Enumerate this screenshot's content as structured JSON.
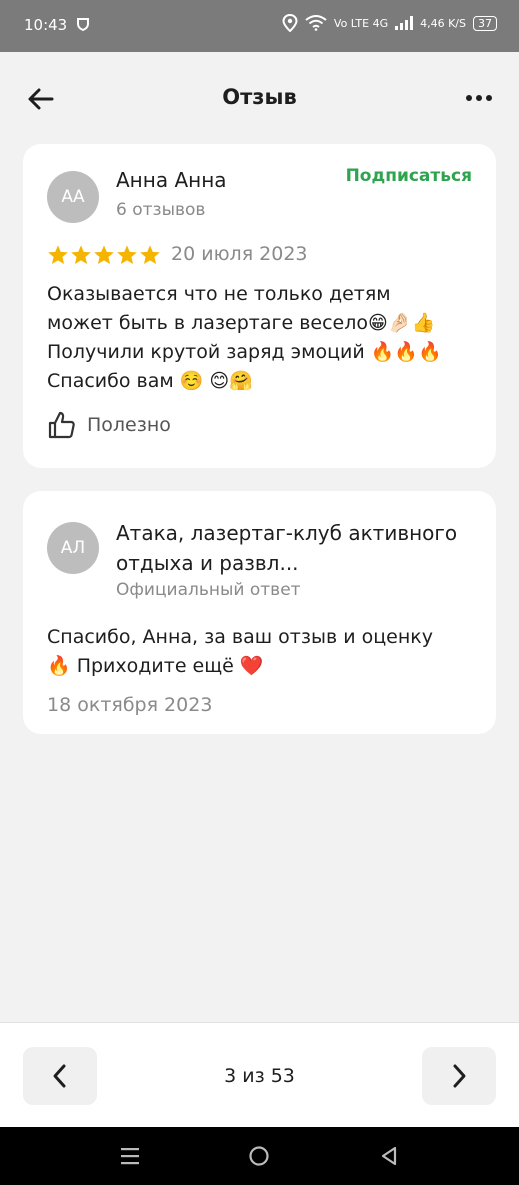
{
  "status_bar": {
    "time": "10:43",
    "network_labels": "Vo LTE 4G",
    "speed": "4,46 K/S",
    "battery": "37"
  },
  "header": {
    "title": "Отзыв"
  },
  "review": {
    "avatar_initials": "АА",
    "author": "Анна Анна",
    "reviews_count": "6 отзывов",
    "subscribe_label": "Подписаться",
    "rating": 5,
    "rating_max": 5,
    "date": "20 июля 2023",
    "text": "Оказывается что не только детям\nможет быть в лазертаге весело😁🤌🏻👍\nПолучили крутой заряд эмоций 🔥🔥🔥\nСпасибо вам ☺️  😊🤗",
    "useful_label": "Полезно"
  },
  "reply": {
    "avatar_initials": "АЛ",
    "org_name": "Атака, лазертаг-клуб активного отдыха и развл...",
    "official_label": "Официальный ответ",
    "text": "Спасибо, Анна, за ваш отзыв и оценку\n🔥 Приходите ещё ❤️",
    "date": "18 октября 2023"
  },
  "pager": {
    "label": "3 из 53"
  },
  "colors": {
    "accent_green": "#2ea44f",
    "star": "#f5b400",
    "avatar_bg": "#bdbdbd"
  }
}
